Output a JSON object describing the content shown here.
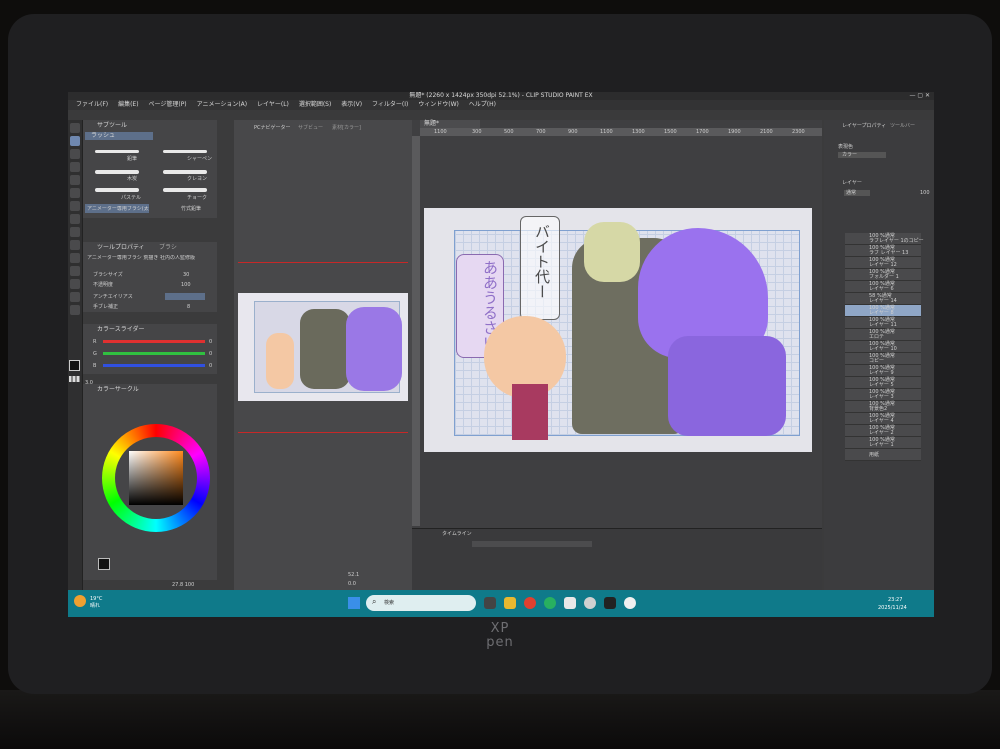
{
  "device": {
    "brand_line1": "XP",
    "brand_line2": "pen"
  },
  "app": {
    "title": "無題* (2260 x 1424px 350dpi 52.1%) - CLIP STUDIO PAINT EX",
    "menu": [
      "ファイル(F)",
      "編集(E)",
      "ページ管理(P)",
      "アニメーション(A)",
      "レイヤー(L)",
      "選択範囲(S)",
      "表示(V)",
      "フィルター(I)",
      "ウィンドウ(W)",
      "ヘルプ(H)"
    ]
  },
  "subtool": {
    "tab": "サブツール",
    "group": "ラッシュ",
    "brushes": [
      {
        "left": "鉛筆",
        "right": "シャーペン"
      },
      {
        "left": "木炭",
        "right": "クレヨン"
      },
      {
        "left": "パステル",
        "right": "チョーク"
      },
      {
        "left": "アニメーター専用ブラシ(太)",
        "right": "竹式鉛筆"
      }
    ]
  },
  "toolprop": {
    "tab": "ツールプロパティ",
    "tab2": "ブラシ",
    "preset": "アニメーター専用ブラシ 荒描き 社内の人監修版",
    "rows": [
      {
        "label": "ブラシサイズ",
        "value": "30"
      },
      {
        "label": "不透明度",
        "value": "100"
      },
      {
        "label": "アンチエイリアス",
        "value": ""
      },
      {
        "label": "手ブレ補正",
        "value": "8"
      }
    ]
  },
  "colorslider": {
    "tab": "カラースライダー",
    "rows": [
      {
        "ch": "R",
        "value": "0",
        "color": "#e03030"
      },
      {
        "ch": "G",
        "value": "0",
        "color": "#30c040"
      },
      {
        "ch": "B",
        "value": "0",
        "color": "#3050e0"
      }
    ]
  },
  "colorwheel": {
    "tab": "カラーサークル",
    "hue_color": "#ff8a1e"
  },
  "size_indicator": {
    "value": "3.0",
    "opacity": "100"
  },
  "navigator": {
    "tab1": "PCナビゲーター",
    "tab2": "サブビュー",
    "tab3": "素材[カラー]",
    "zoom": "52.1",
    "rotate": "0.0"
  },
  "statusbar": {
    "text": "27.8 100"
  },
  "canvas": {
    "tab": "無題*",
    "ruler": [
      "1100",
      "300",
      "500",
      "700",
      "900",
      "1100",
      "1300",
      "1500",
      "1700",
      "1900",
      "2100",
      "2300"
    ],
    "speech1": "バイト代ー",
    "speech2": "ああうるさい"
  },
  "timeline": {
    "tab": "タイムライン"
  },
  "layers": {
    "tab": "レイヤープロパティ",
    "tab2": "ツールバー",
    "expression_label": "表現色",
    "expression_value": "カラー",
    "panel_tab": "レイヤー",
    "blend": "通常",
    "opacity": "100",
    "rows": [
      {
        "pct": "100 %通常",
        "name": "ラフレイヤー 1のコピー",
        "selected": false
      },
      {
        "pct": "100 %通常",
        "name": "ラフ レイヤー 13",
        "selected": false
      },
      {
        "pct": "100 %通常",
        "name": "レイヤー 12",
        "selected": false
      },
      {
        "pct": "100 %通常",
        "name": "フォルダー 1",
        "selected": false
      },
      {
        "pct": "100 %通常",
        "name": "レイヤー 6",
        "selected": false
      },
      {
        "pct": "58 %通常",
        "name": "レイヤー 14",
        "selected": false
      },
      {
        "pct": "100 %通常",
        "name": "レイヤー 8",
        "selected": true
      },
      {
        "pct": "100 %通常",
        "name": "レイヤー 11",
        "selected": false
      },
      {
        "pct": "100 %通常",
        "name": "エロテ",
        "selected": false
      },
      {
        "pct": "100 %通常",
        "name": "レイヤー 10",
        "selected": false
      },
      {
        "pct": "100 %通常",
        "name": "コピー",
        "selected": false
      },
      {
        "pct": "100 %通常",
        "name": "レイヤー 9",
        "selected": false
      },
      {
        "pct": "100 %通常",
        "name": "レイヤー 5",
        "selected": false
      },
      {
        "pct": "100 %通常",
        "name": "レイヤー 3",
        "selected": false
      },
      {
        "pct": "100 %通常",
        "name": "背景色2",
        "selected": false
      },
      {
        "pct": "100 %通常",
        "name": "レイヤー 4",
        "selected": false
      },
      {
        "pct": "100 %通常",
        "name": "レイヤー 2",
        "selected": false
      },
      {
        "pct": "100 %通常",
        "name": "レイヤー 1",
        "selected": false
      },
      {
        "pct": "",
        "name": "用紙",
        "selected": false
      }
    ]
  },
  "taskbar": {
    "weather_temp": "19°C",
    "weather_desc": "晴れ",
    "search_placeholder": "検索",
    "time": "23:27",
    "date": "2025/11/24"
  }
}
